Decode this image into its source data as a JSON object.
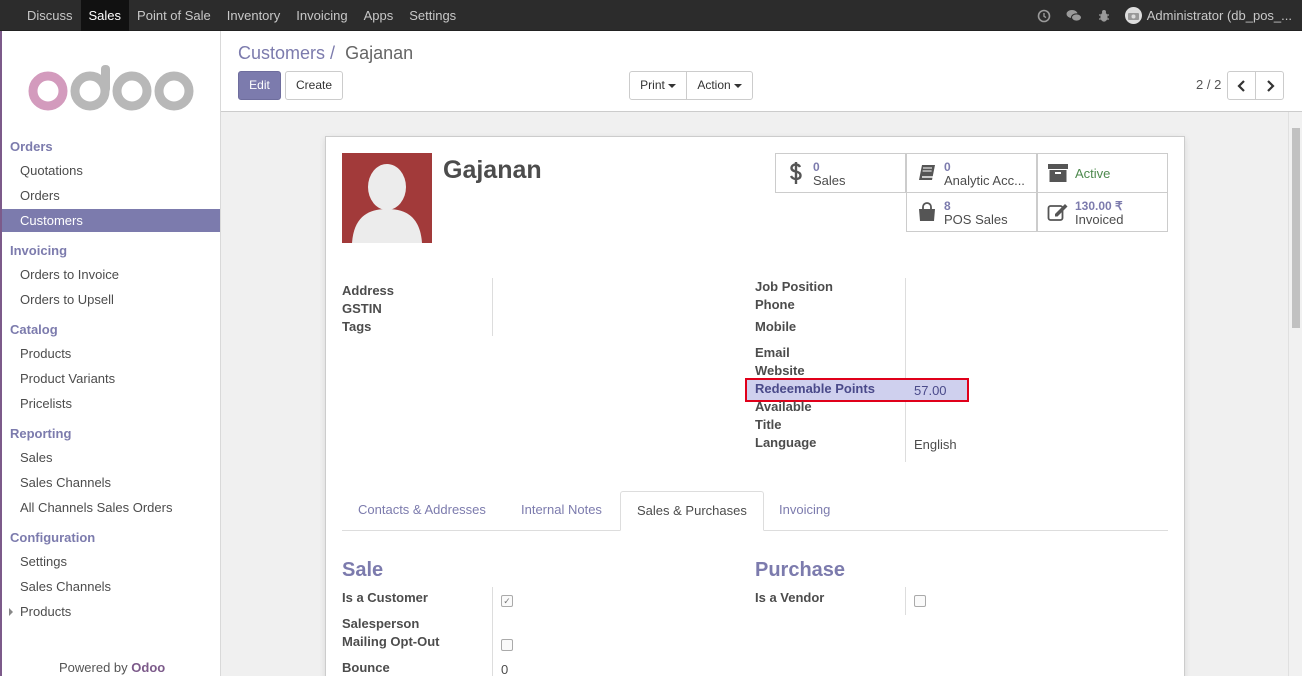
{
  "topnav": {
    "menus": [
      "Discuss",
      "Sales",
      "Point of Sale",
      "Inventory",
      "Invoicing",
      "Apps",
      "Settings"
    ],
    "active": "Sales",
    "user": "Administrator (db_pos_..."
  },
  "sidebar": {
    "logo": "odoo",
    "sections": [
      {
        "title": "Orders",
        "items": [
          "Quotations",
          "Orders",
          "Customers"
        ]
      },
      {
        "title": "Invoicing",
        "items": [
          "Orders to Invoice",
          "Orders to Upsell"
        ]
      },
      {
        "title": "Catalog",
        "items": [
          "Products",
          "Product Variants",
          "Pricelists"
        ]
      },
      {
        "title": "Reporting",
        "items": [
          "Sales",
          "Sales Channels",
          "All Channels Sales Orders"
        ]
      },
      {
        "title": "Configuration",
        "items": [
          "Settings",
          "Sales Channels",
          "Products"
        ]
      }
    ],
    "active_item": "Customers",
    "powered_prefix": "Powered by ",
    "powered_brand": "Odoo"
  },
  "control": {
    "breadcrumb_parent": "Customers",
    "breadcrumb_sep": "/",
    "breadcrumb_current": "Gajanan",
    "edit": "Edit",
    "create": "Create",
    "print": "Print",
    "action": "Action",
    "pager": "2 / 2"
  },
  "record": {
    "name": "Gajanan",
    "smart_buttons": {
      "sales_val": "0",
      "sales_lbl": "Sales",
      "analytic_val": "0",
      "analytic_lbl": "Analytic Acc...",
      "active_lbl": "Active",
      "pos_val": "8",
      "pos_lbl": "POS Sales",
      "invoiced_val": "130.00 ₹",
      "invoiced_lbl": "Invoiced"
    },
    "left_fields": {
      "address": "Address",
      "gstin": "GSTIN",
      "tags": "Tags"
    },
    "right_fields": {
      "job_position": "Job Position",
      "phone": "Phone",
      "mobile": "Mobile",
      "email": "Email",
      "website": "Website",
      "redeemable_points": "Redeemable Points",
      "redeemable_points_value": "57.00",
      "available": "Available",
      "title": "Title",
      "language": "Language",
      "language_value": "English"
    }
  },
  "tabs": [
    "Contacts & Addresses",
    "Internal Notes",
    "Sales & Purchases",
    "Invoicing"
  ],
  "active_tab": "Sales & Purchases",
  "sale": {
    "heading": "Sale",
    "is_customer": "Is a Customer",
    "salesperson": "Salesperson",
    "mailing_opt_out": "Mailing Opt-Out",
    "bounce": "Bounce",
    "bounce_value": "0"
  },
  "purchase": {
    "heading": "Purchase",
    "is_vendor": "Is a Vendor"
  },
  "colors": {
    "accent": "#7c7bad",
    "topbar": "#2c2c2c",
    "highlight_border": "#e0001a"
  }
}
